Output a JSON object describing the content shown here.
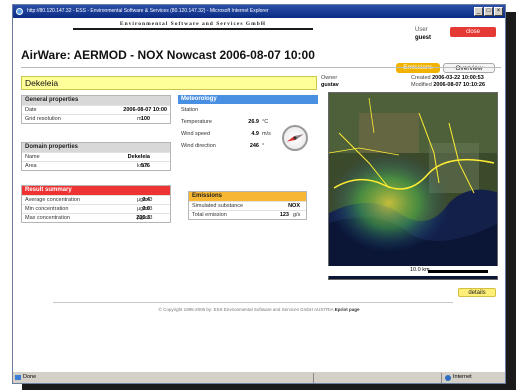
{
  "window": {
    "title": "http://80.120.147.32 - ESS - Environmental Software & Services (80.120.147.32) - Microsoft Internet Explorer",
    "controls": [
      "_",
      "□",
      "×"
    ]
  },
  "header": {
    "banner": "Environmental Software and Services GmbH",
    "user_label": "User",
    "user_name": "guest",
    "close_label": "close",
    "app_title": "AirWare: AERMOD - NOX Nowcast 2006-08-07 10:00"
  },
  "tabs": [
    {
      "label": "Emissions",
      "active": true
    },
    {
      "label": "Overview",
      "active": false
    }
  ],
  "scenario": {
    "name": "Dekeleia",
    "owner_label": "Owner",
    "owner": "gustav",
    "created_label": "Created",
    "created": "2006-03-22 10:00:53",
    "modified_label": "Modified",
    "modified": "2006-08-07 10:10:26"
  },
  "general": {
    "title": "General properties",
    "rows": [
      {
        "label": "Date",
        "value": "2006-08-07 10:00",
        "unit": ""
      },
      {
        "label": "Grid resolution",
        "value": "100",
        "unit": "m"
      }
    ]
  },
  "domain": {
    "title": "Domain properties",
    "rows": [
      {
        "label": "Name",
        "value": "Dekeleia",
        "unit": ""
      },
      {
        "label": "Area",
        "value": "576",
        "unit": "km2"
      }
    ]
  },
  "results": {
    "title": "Result summary",
    "rows": [
      {
        "label": "Average concentration",
        "value": "0.4",
        "unit": "µg/m3"
      },
      {
        "label": "Min concentration",
        "value": "0.0",
        "unit": "µg/m3"
      },
      {
        "label": "Max concentration",
        "value": "235.3",
        "unit": "µg/m3"
      }
    ]
  },
  "meteorology": {
    "title": "Meteorology",
    "station_label": "Station",
    "rows": [
      {
        "label": "Temperature",
        "value": "26.9",
        "unit": "°C"
      },
      {
        "label": "Wind speed",
        "value": "4.9",
        "unit": "m/s"
      },
      {
        "label": "Wind direction",
        "value": "246",
        "unit": "°"
      }
    ],
    "wind_direction_deg": 246
  },
  "emissions": {
    "title": "Emissions",
    "rows": [
      {
        "label": "Simulated substance",
        "value": "NOX",
        "unit": ""
      },
      {
        "label": "Total emission",
        "value": "123",
        "unit": "g/s"
      }
    ]
  },
  "map": {
    "scale_label": "10.0 km"
  },
  "details_label": "details",
  "footer": {
    "text": "© Copyright 1995-2006 by: ESS Environmental Software and Services GmbH AUSTRIA",
    "link": "Eprint page"
  },
  "statusbar": {
    "status": "Done",
    "zone": "Internet"
  },
  "colors": {
    "accent_orange": "#f0b400",
    "close_red": "#e53935",
    "result_red": "#ee3333",
    "meteo_blue": "#4a90e2",
    "name_yellow": "#ffff99"
  }
}
